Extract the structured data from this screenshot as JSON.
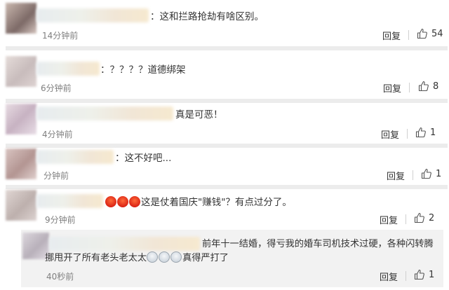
{
  "comments": [
    {
      "text": "：这和拦路抢劫有啥区别。",
      "time": "14分钟前",
      "reply": "回复",
      "likes": "54"
    },
    {
      "text": "：？？？？道德绑架",
      "time": "6分钟前",
      "reply": "回复",
      "likes": "8"
    },
    {
      "text": "真是可恶！",
      "time": "4分钟前",
      "reply": "回复",
      "likes": "1"
    },
    {
      "text": "：这不好吧...",
      "time": "分钟前",
      "reply": "回复",
      "likes": "1"
    },
    {
      "text": "这是仗着国庆\"赚钱\"？有点过分了。",
      "time": "9分钟前",
      "reply": "回复",
      "likes": "2"
    }
  ],
  "subreply": {
    "line1": "前年十一结婚，得亏我的婚车司机技术过硬，各种闪转腾",
    "line2_start": "挪甩开了所有老头老太太",
    "line2_end": "真得严打了",
    "time": "40秒前",
    "reply": "回复",
    "likes": "1"
  },
  "icons": {
    "like": "thumbs-up-icon",
    "angry": "angry-face-emoji",
    "cry": "crying-face-emoji"
  },
  "colors": {
    "text": "#333333",
    "meta": "#808080",
    "separator": "#ececec"
  }
}
